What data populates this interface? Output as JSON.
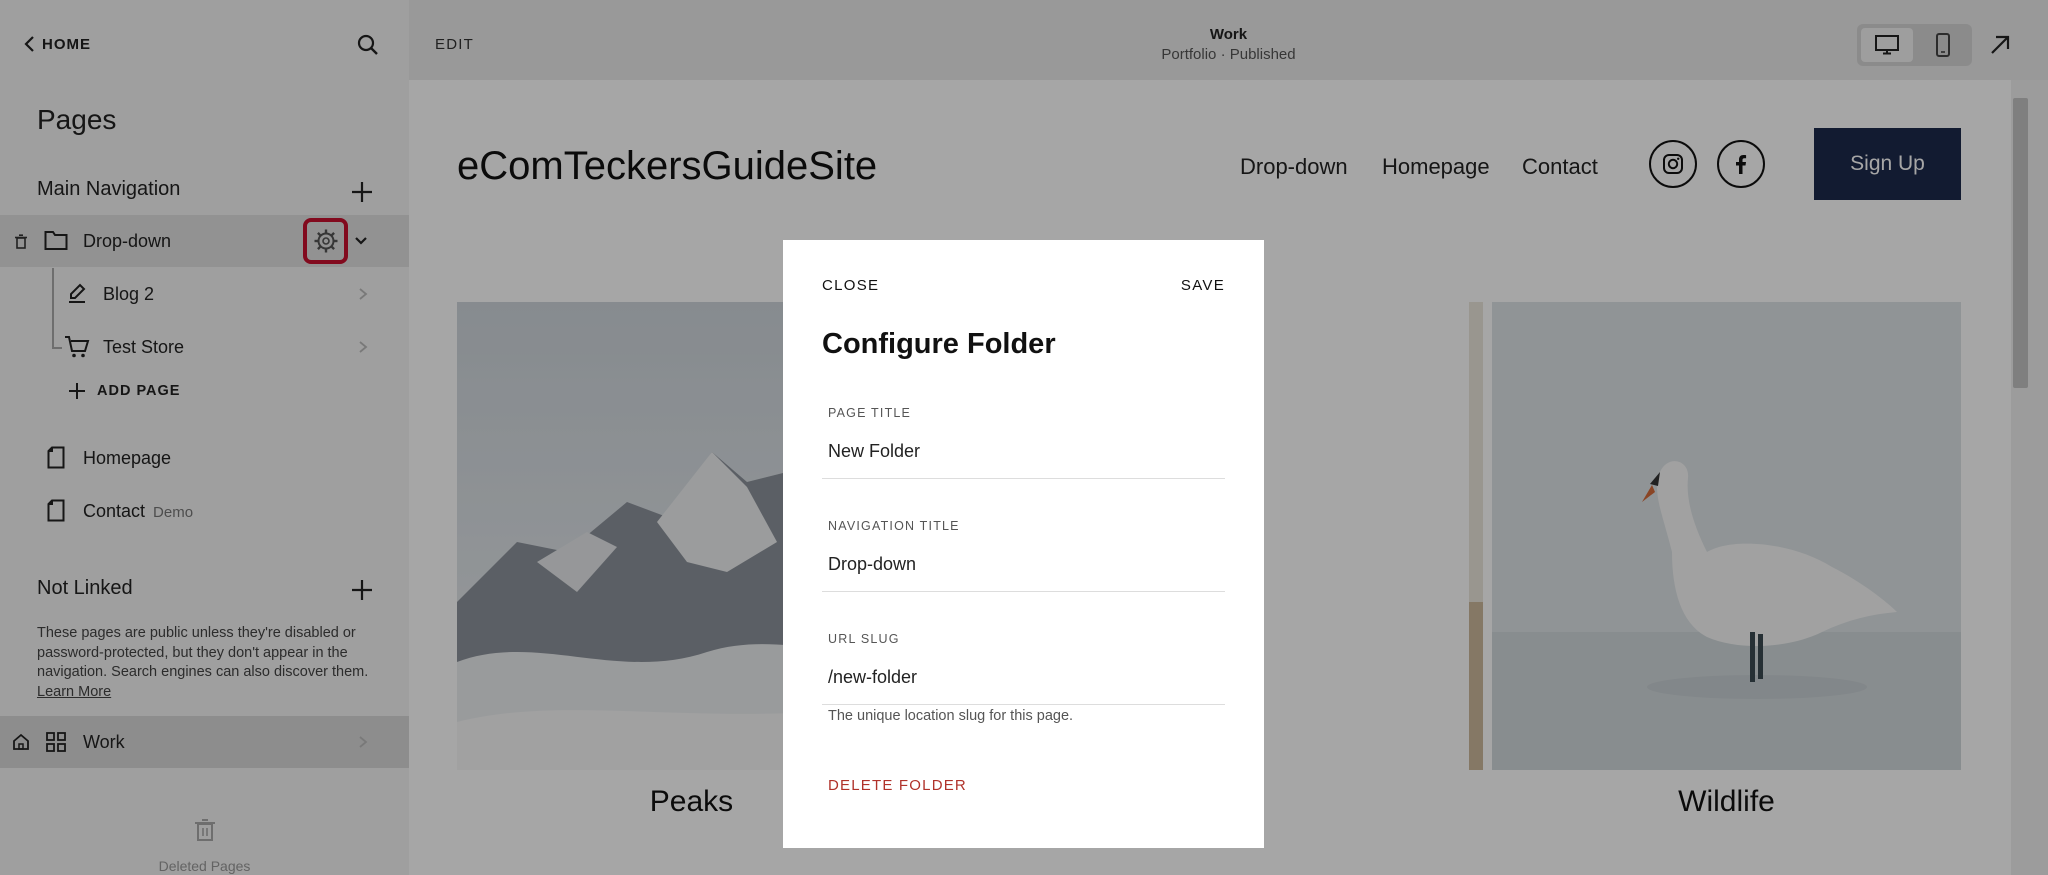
{
  "sidebar": {
    "home_label": "HOME",
    "pages_title": "Pages",
    "main_navigation": {
      "heading": "Main Navigation",
      "items": [
        {
          "label": "Drop-down"
        },
        {
          "label": "Blog 2"
        },
        {
          "label": "Test Store"
        },
        {
          "label": "ADD PAGE"
        },
        {
          "label": "Homepage"
        },
        {
          "label": "Contact",
          "tag": "Demo"
        }
      ]
    },
    "not_linked": {
      "heading": "Not Linked",
      "description": "These pages are public unless they're disabled or password-protected, but they don't appear in the navigation. Search engines can also discover them.",
      "learn_more": "Learn More",
      "items": [
        {
          "label": "Work"
        }
      ]
    },
    "deleted_pages_label": "Deleted Pages"
  },
  "topbar": {
    "edit_label": "EDIT",
    "page_name": "Work",
    "page_status": "Portfolio · Published"
  },
  "site": {
    "title": "eComTeckersGuideSite",
    "nav": [
      "Drop-down",
      "Homepage",
      "Contact"
    ],
    "signup_label": "Sign Up",
    "gallery": [
      {
        "caption": "Peaks"
      },
      {
        "caption": "Wildlife"
      }
    ]
  },
  "modal": {
    "close_label": "CLOSE",
    "save_label": "SAVE",
    "title": "Configure Folder",
    "fields": {
      "page_title": {
        "label": "PAGE TITLE",
        "value": "New Folder"
      },
      "navigation_title": {
        "label": "NAVIGATION TITLE",
        "value": "Drop-down"
      },
      "url_slug": {
        "label": "URL SLUG",
        "value": "/new-folder",
        "help": "The unique location slug for this page."
      }
    },
    "delete_label": "DELETE FOLDER"
  },
  "colors": {
    "highlight_ring": "#c8102e",
    "signup_button": "#1d2a4c",
    "delete_text": "#b0322a"
  }
}
